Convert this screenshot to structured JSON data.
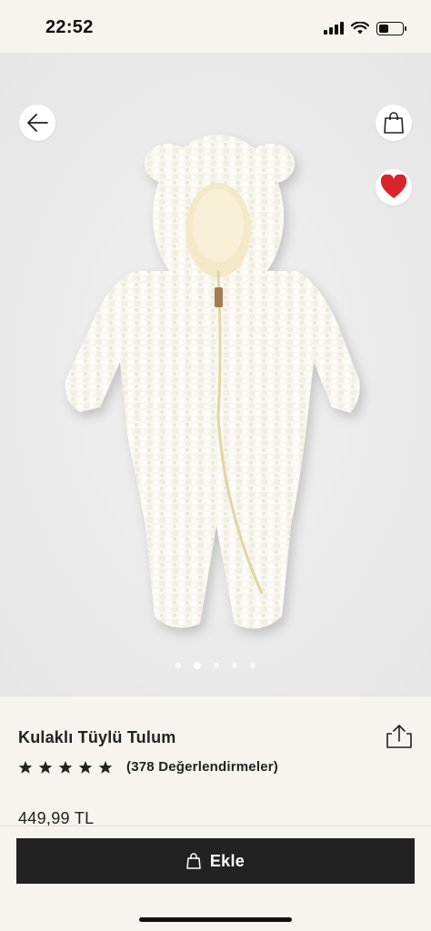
{
  "status_bar": {
    "time": "22:52",
    "battery_level": 0.45
  },
  "navigation": {
    "back_icon": "arrow-left-icon",
    "bag_icon": "shopping-bag-icon",
    "favorite_icon": "heart-filled-icon",
    "favorite_color": "#d8242b"
  },
  "carousel": {
    "total": 5,
    "active_index": 1
  },
  "product": {
    "title": "Kulaklı Tüylü Tulum",
    "rating_stars": 5,
    "reviews_text": "(378 Değerlendirmeler)",
    "price": "449,99 TL",
    "share_icon": "share-icon"
  },
  "actions": {
    "add_label": "Ekle",
    "add_icon": "shopping-bag-icon",
    "button_color": "#222222"
  }
}
